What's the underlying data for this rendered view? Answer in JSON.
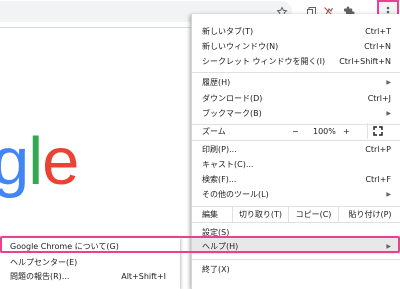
{
  "toolbar": {
    "icons": [
      "star-icon",
      "tab-search-icon",
      "extension-off-icon",
      "puzzle-icon",
      "more-vert-icon"
    ]
  },
  "logo": {
    "letters": [
      {
        "ch": "g",
        "color": "#4285f4"
      },
      {
        "ch": "l",
        "color": "#34a853"
      },
      {
        "ch": "e",
        "color": "#ea4335"
      }
    ]
  },
  "menu": {
    "new_tab": {
      "label": "新しいタブ(T)",
      "shortcut": "Ctrl+T"
    },
    "new_window": {
      "label": "新しいウィンドウ(N)",
      "shortcut": "Ctrl+N"
    },
    "incognito": {
      "label": "シークレット ウィンドウを開く(I)",
      "shortcut": "Ctrl+Shift+N"
    },
    "history": {
      "label": "履歴(H)"
    },
    "downloads": {
      "label": "ダウンロード(D)",
      "shortcut": "Ctrl+J"
    },
    "bookmarks": {
      "label": "ブックマーク(B)"
    },
    "zoom": {
      "label": "ズーム",
      "minus": "−",
      "value": "100%",
      "plus": "+"
    },
    "print": {
      "label": "印刷(P)...",
      "shortcut": "Ctrl+P"
    },
    "cast": {
      "label": "キャスト(C)..."
    },
    "find": {
      "label": "検索(F)...",
      "shortcut": "Ctrl+F"
    },
    "more_tools": {
      "label": "その他のツール(L)"
    },
    "edit": {
      "label": "編集",
      "cut": "切り取り(T)",
      "copy": "コピー(C)",
      "paste": "貼り付け(P)"
    },
    "settings": {
      "label": "設定(S)"
    },
    "help": {
      "label": "ヘルプ(H)"
    },
    "exit": {
      "label": "終了(X)"
    }
  },
  "submenu": {
    "about": {
      "label": "Google Chrome について(G)"
    },
    "help_center": {
      "label": "ヘルプセンター(E)"
    },
    "report": {
      "label": "問題の報告(R)...",
      "shortcut": "Alt+Shift+I"
    }
  },
  "colors": {
    "highlight": "#ee3f8e",
    "hover": "#e8e8e8"
  }
}
